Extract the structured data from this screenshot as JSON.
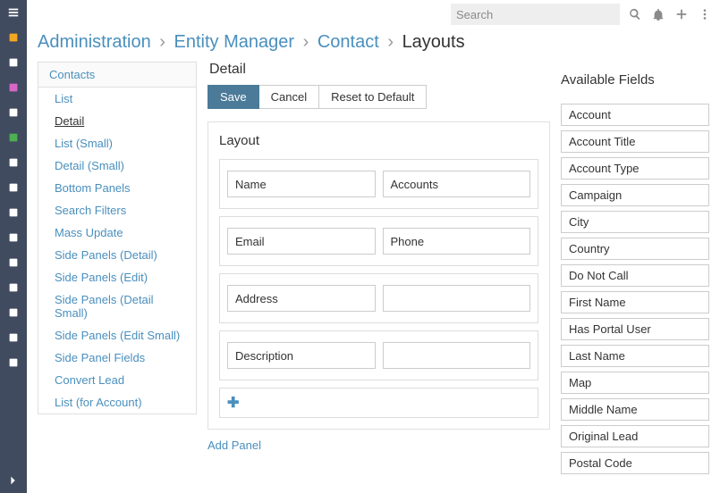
{
  "header": {
    "search_placeholder": "Search"
  },
  "breadcrumb": {
    "administration": "Administration",
    "entity_manager": "Entity Manager",
    "contact": "Contact",
    "layouts": "Layouts"
  },
  "sidebar_panel": {
    "title": "Contacts",
    "items": [
      "List",
      "Detail",
      "List (Small)",
      "Detail (Small)",
      "Bottom Panels",
      "Search Filters",
      "Mass Update",
      "Side Panels (Detail)",
      "Side Panels (Edit)",
      "Side Panels (Detail Small)",
      "Side Panels (Edit Small)",
      "Side Panel Fields",
      "Convert Lead",
      "List (for Account)"
    ],
    "active_index": 1
  },
  "center": {
    "heading": "Detail",
    "buttons": {
      "save": "Save",
      "cancel": "Cancel",
      "reset": "Reset to Default"
    },
    "layout_label": "Layout",
    "rows": [
      [
        "Name",
        "Accounts"
      ],
      [
        "Email",
        "Phone"
      ],
      [
        "Address",
        ""
      ],
      [
        "Description",
        ""
      ]
    ],
    "add_panel": "Add Panel"
  },
  "available": {
    "title": "Available Fields",
    "items": [
      "Account",
      "Account Title",
      "Account Type",
      "Campaign",
      "City",
      "Country",
      "Do Not Call",
      "First Name",
      "Has Portal User",
      "Last Name",
      "Map",
      "Middle Name",
      "Original Lead",
      "Postal Code"
    ]
  },
  "sidebar_icons": [
    "menu",
    "dashboard",
    "module-a",
    "module-b",
    "module-c",
    "currency",
    "chart",
    "doc1",
    "doc2",
    "doc3",
    "box",
    "mail",
    "briefcase",
    "calendar",
    "list"
  ]
}
